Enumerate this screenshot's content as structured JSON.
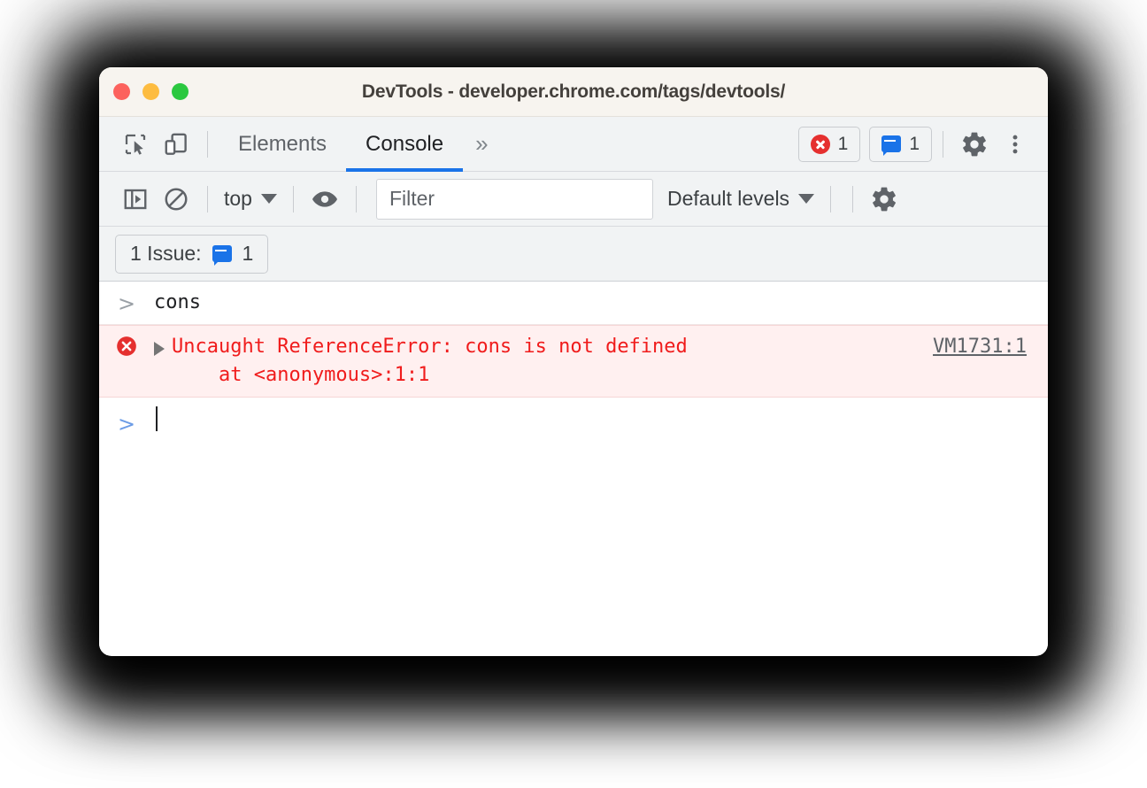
{
  "window": {
    "title": "DevTools - developer.chrome.com/tags/devtools/",
    "traffic_lights": [
      {
        "name": "close",
        "color": "#fc625d"
      },
      {
        "name": "minimize",
        "color": "#fdbc40"
      },
      {
        "name": "maximize",
        "color": "#2bc840"
      }
    ]
  },
  "tabbar": {
    "inspect_icon": "inspect-element-icon",
    "device_icon": "device-toolbar-icon",
    "tabs": [
      {
        "label": "Elements",
        "active": false
      },
      {
        "label": "Console",
        "active": true
      }
    ],
    "more_tabs_label": "»",
    "error_badge": {
      "icon": "error-circle-icon",
      "count": "1"
    },
    "issues_badge": {
      "icon": "issue-message-icon",
      "count": "1"
    },
    "settings_icon": "gear-icon",
    "more_options_icon": "kebab-menu-icon"
  },
  "filterbar": {
    "sidebar_toggle_icon": "console-sidebar-icon",
    "clear_console_icon": "clear-console-icon",
    "context_selector": {
      "label": "top",
      "caret": "chevron-down-icon"
    },
    "live_expression_icon": "eye-icon",
    "filter": {
      "placeholder": "Filter",
      "value": ""
    },
    "levels_selector": {
      "label": "Default levels",
      "caret": "chevron-down-icon"
    },
    "settings_icon": "gear-icon"
  },
  "issuebar": {
    "label": "1 Issue:",
    "icon": "issue-message-icon",
    "count": "1"
  },
  "console": {
    "entries": [
      {
        "type": "input",
        "prompt": ">",
        "text": "cons"
      },
      {
        "type": "error",
        "icon": "error-circle-icon",
        "expander": "expand-triangle-icon",
        "line1": "Uncaught ReferenceError: cons is not defined",
        "line2": "    at <anonymous>:1:1",
        "source_link": "VM1731:1"
      },
      {
        "type": "prompt",
        "prompt": ">",
        "text": ""
      }
    ]
  },
  "colors": {
    "accent_blue": "#1a73e8",
    "error_red": "#f01c1c",
    "error_bg": "#fff0f0",
    "toolbar_bg": "#f1f3f4",
    "titlebar_bg": "#f7f4ef"
  }
}
